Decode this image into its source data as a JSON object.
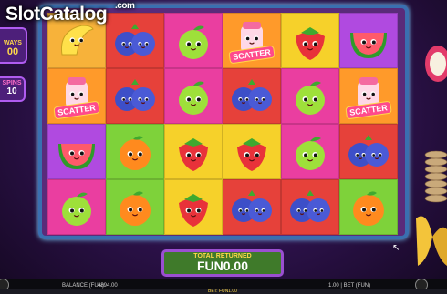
{
  "watermark": {
    "text": "SlotCatalog",
    "suffix": ".com"
  },
  "ways": {
    "label": "WAYS",
    "value": "00"
  },
  "free_spins": {
    "label": "SPINS",
    "value": "10"
  },
  "grid": {
    "rows": [
      [
        {
          "symbol": "banana",
          "bg": "#f7b23a"
        },
        {
          "symbol": "blueberry",
          "bg": "#e6413a"
        },
        {
          "symbol": "apple",
          "bg": "#ea3ea0"
        },
        {
          "symbol": "scatter",
          "bg": "#ff9a2a",
          "label": "SCATTER"
        },
        {
          "symbol": "strawberry",
          "bg": "#f6d12a"
        },
        {
          "symbol": "watermelon",
          "bg": "#b04ae0"
        }
      ],
      [
        {
          "symbol": "scatter",
          "bg": "#ff9a2a",
          "label": "SCATTER"
        },
        {
          "symbol": "blueberry",
          "bg": "#e6413a"
        },
        {
          "symbol": "apple",
          "bg": "#ea3ea0"
        },
        {
          "symbol": "blueberry",
          "bg": "#e6413a"
        },
        {
          "symbol": "apple",
          "bg": "#ea3ea0"
        },
        {
          "symbol": "scatter",
          "bg": "#ff9a2a",
          "label": "SCATTER"
        }
      ],
      [
        {
          "symbol": "watermelon",
          "bg": "#b04ae0"
        },
        {
          "symbol": "orange",
          "bg": "#7ed23a"
        },
        {
          "symbol": "strawberry",
          "bg": "#f6d12a"
        },
        {
          "symbol": "strawberry",
          "bg": "#f6d12a"
        },
        {
          "symbol": "apple",
          "bg": "#ea3ea0"
        },
        {
          "symbol": "blueberry",
          "bg": "#e6413a"
        }
      ],
      [
        {
          "symbol": "apple",
          "bg": "#ea3ea0"
        },
        {
          "symbol": "orange",
          "bg": "#7ed23a"
        },
        {
          "symbol": "strawberry",
          "bg": "#f6d12a"
        },
        {
          "symbol": "blueberry",
          "bg": "#e6413a"
        },
        {
          "symbol": "blueberry",
          "bg": "#e6413a"
        },
        {
          "symbol": "orange",
          "bg": "#7ed23a"
        }
      ]
    ]
  },
  "total_returned": {
    "label": "TOTAL RETURNED",
    "value": "FUN0.00"
  },
  "bottom": {
    "balance_label": "BALANCE (FUN)",
    "balance_value": "4894.00",
    "bet_label": "1.00 | BET (FUN)",
    "bet_footer": "BET: FUN1.00"
  },
  "colors": {
    "frame_border": "#3a6fb0",
    "panel_green": "#3f7a2a",
    "accent_yellow": "#ffd84a"
  }
}
